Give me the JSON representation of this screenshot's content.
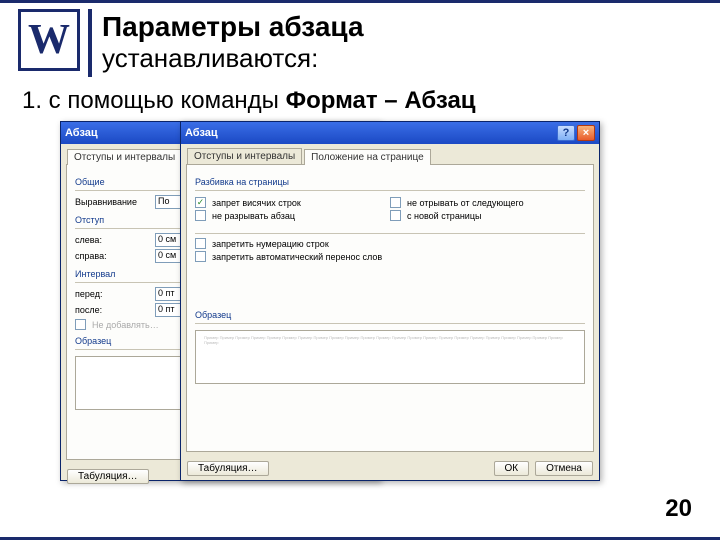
{
  "slide": {
    "logo_letter": "W",
    "title_bold": "Параметры абзаца",
    "title_rest": "устанавливаются:",
    "line1_prefix": "1. с помощью команды ",
    "line1_bold": "Формат – Абзац",
    "page_number": "20"
  },
  "dlg_back": {
    "title": "Абзац",
    "tab1": "Отступы и интервалы",
    "grp_general": "Общие",
    "lbl_align": "Выравнивание",
    "val_align": "По",
    "grp_indent": "Отступ",
    "lbl_left": "слева:",
    "val_left": "0 см",
    "lbl_right": "справа:",
    "val_right": "0 см",
    "grp_spacing": "Интервал",
    "lbl_before": "перед:",
    "val_before": "0 пт",
    "lbl_after": "после:",
    "val_after": "0 пт",
    "cb_nospace": "Не добавлять…",
    "grp_sample": "Образец",
    "btn_tabs": "Табуляция…"
  },
  "dlg_front": {
    "title": "Абзац",
    "tab1": "Отступы и интервалы",
    "tab2": "Положение на странице",
    "grp_pagination": "Разбивка на страницы",
    "cb_widow": "запрет висячих строк",
    "cb_keepnext": "не отрывать от следующего",
    "cb_keeplines": "не разрывать абзац",
    "cb_newpage": "с новой страницы",
    "cb_supnum": "запретить нумерацию строк",
    "cb_suphyp": "запретить автоматический перенос слов",
    "grp_sample": "Образец",
    "preview_text": "Пример Пример Пример Пример Пример Пример Пример Пример Пример Пример Пример Пример Пример Пример Пример Пример Пример Пример Пример Пример Пример Пример Пример Пример",
    "btn_tabs": "Табуляция…",
    "btn_ok": "ОК",
    "btn_cancel": "Отмена"
  }
}
